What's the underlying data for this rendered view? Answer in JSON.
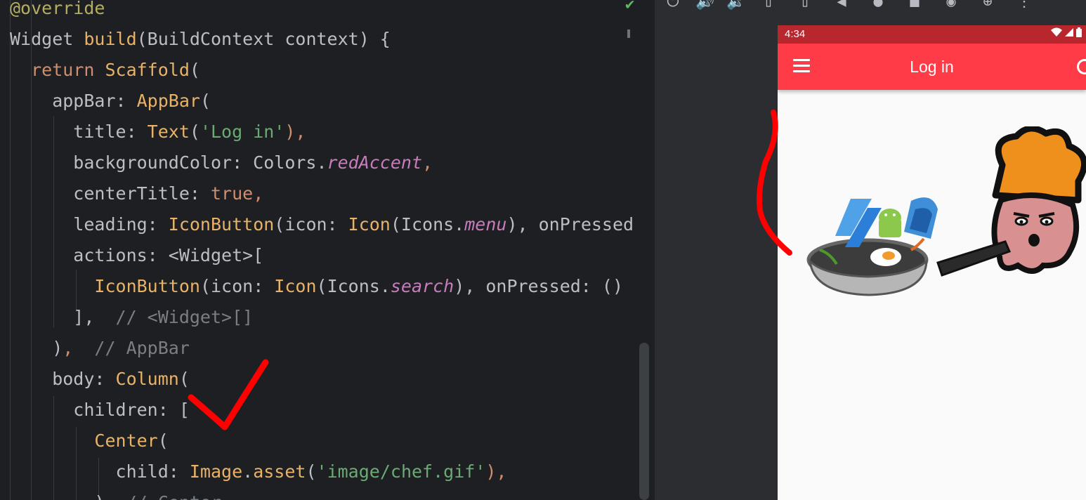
{
  "editor": {
    "lines": [
      [
        {
          "t": "@override",
          "c": "ann"
        }
      ],
      [
        {
          "t": "Widget ",
          "c": "plain"
        },
        {
          "t": "build",
          "c": "fn"
        },
        {
          "t": "(BuildContext context) {",
          "c": "plain"
        }
      ],
      [
        {
          "t": "  ",
          "c": "plain"
        },
        {
          "t": "return ",
          "c": "kw"
        },
        {
          "t": "Scaffold",
          "c": "fn"
        },
        {
          "t": "(",
          "c": "plain"
        }
      ],
      [
        {
          "t": "    appBar: ",
          "c": "plain"
        },
        {
          "t": "AppBar",
          "c": "fn"
        },
        {
          "t": "(",
          "c": "plain"
        }
      ],
      [
        {
          "t": "      title: ",
          "c": "plain"
        },
        {
          "t": "Text",
          "c": "fn"
        },
        {
          "t": "(",
          "c": "plain"
        },
        {
          "t": "'Log in'",
          "c": "str"
        },
        {
          "t": "),",
          "c": "kw"
        }
      ],
      [
        {
          "t": "      backgroundColor: Colors.",
          "c": "plain"
        },
        {
          "t": "redAccent",
          "c": "cst"
        },
        {
          "t": ",",
          "c": "kw"
        }
      ],
      [
        {
          "t": "      centerTitle: ",
          "c": "plain"
        },
        {
          "t": "true",
          "c": "kw"
        },
        {
          "t": ",",
          "c": "kw"
        }
      ],
      [
        {
          "t": "      leading: ",
          "c": "plain"
        },
        {
          "t": "IconButton",
          "c": "fn"
        },
        {
          "t": "(icon: ",
          "c": "plain"
        },
        {
          "t": "Icon",
          "c": "fn"
        },
        {
          "t": "(Icons.",
          "c": "plain"
        },
        {
          "t": "menu",
          "c": "cst"
        },
        {
          "t": "), ",
          "c": "plain"
        },
        {
          "t": "onPressed",
          "c": "plain"
        }
      ],
      [
        {
          "t": "      actions: <Widget>[",
          "c": "plain"
        }
      ],
      [
        {
          "t": "        ",
          "c": "plain"
        },
        {
          "t": "IconButton",
          "c": "fn"
        },
        {
          "t": "(icon: ",
          "c": "plain"
        },
        {
          "t": "Icon",
          "c": "fn"
        },
        {
          "t": "(Icons.",
          "c": "plain"
        },
        {
          "t": "search",
          "c": "cst"
        },
        {
          "t": "), onPressed: ()",
          "c": "plain"
        }
      ],
      [
        {
          "t": "      ],",
          "c": "plain"
        },
        {
          "t": "  // <Widget>[]",
          "c": "cmt"
        }
      ],
      [
        {
          "t": "    )",
          "c": "plain"
        },
        {
          "t": ",",
          "c": "kw"
        },
        {
          "t": "  // AppBar",
          "c": "cmt"
        }
      ],
      [
        {
          "t": "    body: ",
          "c": "plain"
        },
        {
          "t": "Column",
          "c": "fn"
        },
        {
          "t": "(",
          "c": "plain"
        }
      ],
      [
        {
          "t": "      children: [",
          "c": "plain"
        }
      ],
      [
        {
          "t": "        ",
          "c": "plain"
        },
        {
          "t": "Center",
          "c": "fn"
        },
        {
          "t": "(",
          "c": "plain"
        }
      ],
      [
        {
          "t": "          child: ",
          "c": "plain"
        },
        {
          "t": "Image",
          "c": "fn"
        },
        {
          "t": ".",
          "c": "plain"
        },
        {
          "t": "asset",
          "c": "fn"
        },
        {
          "t": "(",
          "c": "plain"
        },
        {
          "t": "'image/chef.gif'",
          "c": "str"
        },
        {
          "t": "),",
          "c": "kw"
        }
      ],
      [
        {
          "t": "        ), ",
          "c": "plain"
        },
        {
          "t": "// Center",
          "c": "cmt"
        }
      ]
    ]
  },
  "emulator": {
    "toolbar_icons": [
      "power-icon",
      "volume-up-icon",
      "volume-down-icon",
      "rotate-left-icon",
      "rotate-right-icon",
      "back-icon",
      "home-icon",
      "overview-icon",
      "camera-icon",
      "zoom-icon",
      "more-icon"
    ],
    "status_time": "4:34",
    "app_title": "Log in"
  },
  "colors": {
    "app_bar": "#ff3b47",
    "status_bar": "#b8262e",
    "annotation": "#ff0000"
  }
}
